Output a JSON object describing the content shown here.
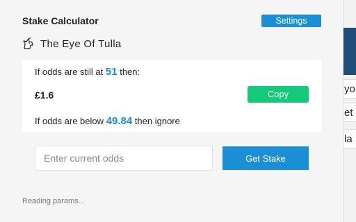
{
  "popup": {
    "title": "Stake Calculator",
    "settings_label": "Settings",
    "event_icon": "unicorn-icon",
    "event_name": "The Eye Of Tulla",
    "card": {
      "line1_prefix": "If odds are still at",
      "line1_odds": "51",
      "line1_suffix": "then:",
      "stake": "£1.6",
      "copy_label": "Copy",
      "line2_prefix": "If odds are below",
      "line2_odds": "49.84",
      "line2_suffix": "then ignore"
    },
    "odds_input": {
      "value": "",
      "placeholder": "Enter current odds"
    },
    "get_stake_label": "Get Stake",
    "status": "Reading params..."
  },
  "background": {
    "row1": "yo",
    "row2": "et",
    "row3": "la"
  },
  "colors": {
    "accent": "#1a8fd6",
    "copy": "#14c97a"
  }
}
